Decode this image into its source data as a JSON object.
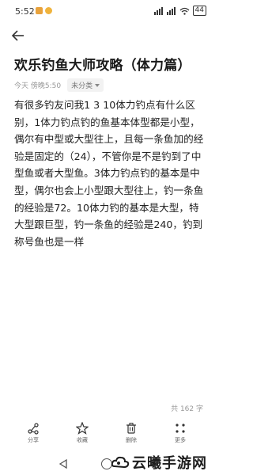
{
  "status_bar": {
    "time": "5:52",
    "battery": "44"
  },
  "article": {
    "title": "欢乐钓鱼大师攻略（体力篇）",
    "date": "今天 傍晚5:50",
    "category": "未分类",
    "body": "有很多钓友问我1 3 10体力钓点有什么区别，1体力钓点钓的鱼基本体型都是小型，偶尔有中型或大型往上，且每一条鱼加的经验是固定的（24），不管你是不是钓到了中型鱼或者大型鱼。3体力钓点钓的基本是中型，偶尔也会上小型跟大型往上，钓一条鱼的经验是72。10体力钓的基本是大型，特大型跟巨型，钓一条鱼的经验是240，钓到称号鱼也是一样",
    "word_count": "共 162 字"
  },
  "toolbar": {
    "share": "分享",
    "favorite": "收藏",
    "delete": "删除",
    "more": "更多"
  },
  "watermark": {
    "text": "云曦手游网"
  }
}
